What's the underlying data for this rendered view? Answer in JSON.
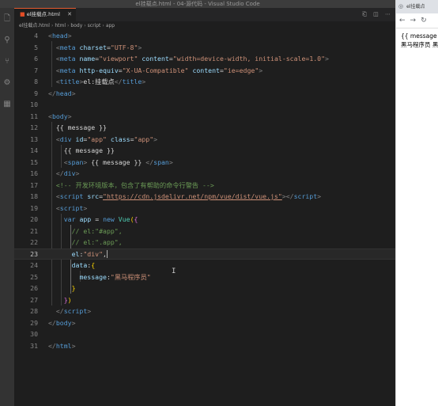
{
  "window": {
    "title": "el挂载点.html - 04-源代码 - Visual Studio Code"
  },
  "activity_bar": [
    "files-icon",
    "search-icon",
    "source-control-icon",
    "debug-icon",
    "extensions-icon"
  ],
  "tab": {
    "label": "el挂载点.html",
    "icon": "html-file-icon"
  },
  "tab_actions": [
    "split-compare-icon",
    "split-editor-icon",
    "more-icon"
  ],
  "breadcrumb": {
    "file": "el挂载点.html",
    "items": [
      "html",
      "body",
      "script",
      "app"
    ]
  },
  "code": {
    "lines": [
      {
        "n": "4"
      },
      {
        "n": "5"
      },
      {
        "n": "6"
      },
      {
        "n": "7"
      },
      {
        "n": "8"
      },
      {
        "n": "9"
      },
      {
        "n": "10"
      },
      {
        "n": "11"
      },
      {
        "n": "12"
      },
      {
        "n": "13"
      },
      {
        "n": "14"
      },
      {
        "n": "15"
      },
      {
        "n": "16"
      },
      {
        "n": "17"
      },
      {
        "n": "18"
      },
      {
        "n": "19"
      },
      {
        "n": "20"
      },
      {
        "n": "21"
      },
      {
        "n": "22"
      },
      {
        "n": "23"
      },
      {
        "n": "24"
      },
      {
        "n": "25"
      },
      {
        "n": "26"
      },
      {
        "n": "27"
      },
      {
        "n": "28"
      },
      {
        "n": "29"
      },
      {
        "n": "30"
      },
      {
        "n": "31"
      }
    ],
    "head_open": "head",
    "meta": "meta",
    "charset_attr": "charset",
    "charset_val": "\"UTF-8\"",
    "name_attr": "name",
    "viewport_val": "\"viewport\"",
    "content_attr": "content",
    "viewport_content": "\"width=device-width, initial-scale=1.0\"",
    "http_equiv_attr": "http-equiv",
    "http_equiv_val": "\"X-UA-Compatible\"",
    "ie_content": "\"ie=edge\"",
    "title_tag": "title",
    "title_text": "el:挂载点",
    "body_tag": "body",
    "mustache_text": "{{ message }}",
    "div_tag": "div",
    "id_attr": "id",
    "app_val": "\"app\"",
    "class_attr": "class",
    "span_tag": "span",
    "comment": "<!-- 开发环境版本，包含了有帮助的命令行警告 -->",
    "script_tag": "script",
    "src_attr": "src",
    "src_url": "\"https://cdn.jsdelivr.net/npm/vue/dist/vue.js\"",
    "var_kw": "var",
    "app_var": "app",
    "new_kw": "new",
    "vue_cls": "Vue",
    "comment_el_id": "// el:\"#app\",",
    "comment_el_class": "// el:\".app\",",
    "el_key": "el",
    "el_val": "\"div\"",
    "data_key": "data",
    "message_key": "message",
    "message_val": "\"黑马程序员\"",
    "html_tag": "html"
  },
  "browser": {
    "tab_title": "el挂载点",
    "nav": [
      "back-arrow-icon",
      "forward-arrow-icon",
      "reload-icon"
    ],
    "content_lines": [
      "{{ message }}",
      "黑马程序员 黑"
    ]
  }
}
